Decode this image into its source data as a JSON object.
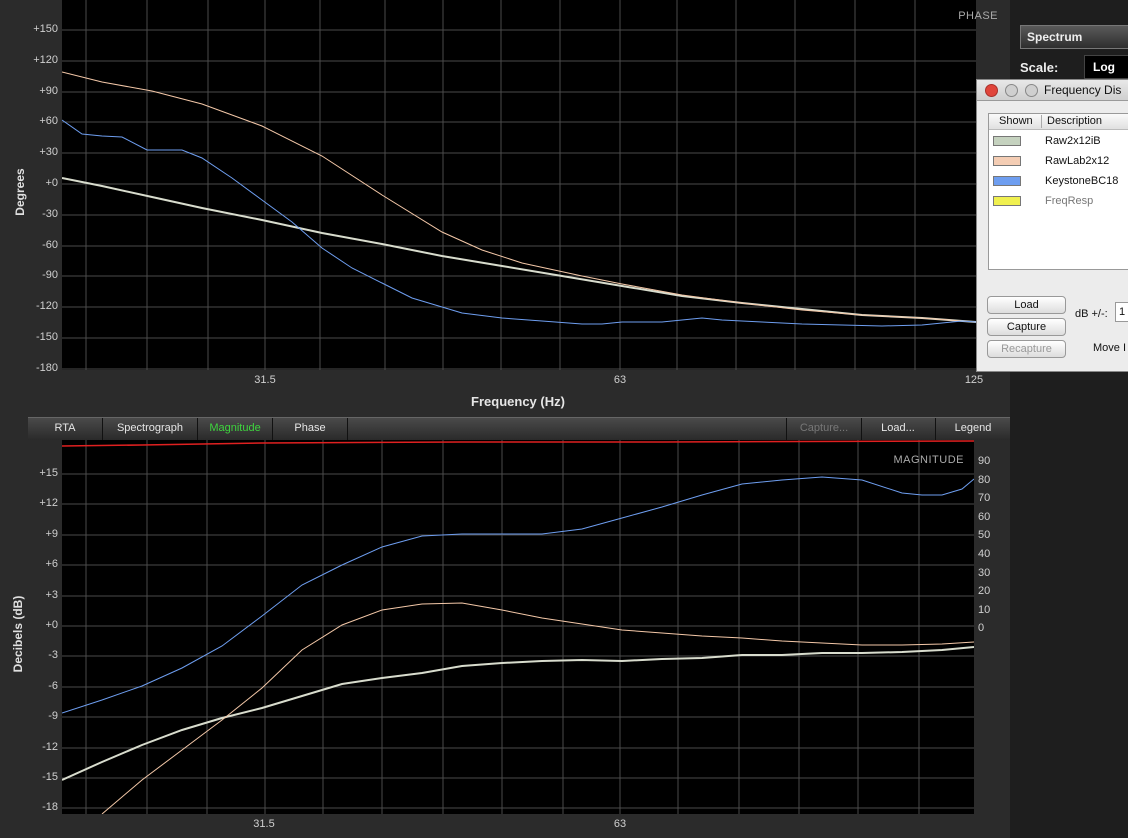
{
  "phase_plot": {
    "tag": "PHASE",
    "ylabel": "Degrees",
    "xlabel": "Frequency (Hz)",
    "yticks": [
      "+150",
      "+120",
      "+90",
      "+60",
      "+30",
      "+0",
      "-30",
      "-60",
      "-90",
      "-120",
      "-150",
      "-180"
    ],
    "xticks": [
      "31.5",
      "63",
      "125"
    ]
  },
  "tabs": {
    "rta": "RTA",
    "spectrograph": "Spectrograph",
    "magnitude": "Magnitude",
    "phase": "Phase",
    "capture": "Capture...",
    "load": "Load...",
    "legend": "Legend"
  },
  "magnitude_plot": {
    "tag": "MAGNITUDE",
    "ylabel": "Decibels (dB)",
    "yticks": [
      "+15",
      "+12",
      "+9",
      "+6",
      "+3",
      "+0",
      "-3",
      "-6",
      "-9",
      "-12",
      "-15",
      "-18"
    ],
    "yticks_right": [
      "90",
      "80",
      "70",
      "60",
      "50",
      "40",
      "30",
      "20",
      "10",
      "0"
    ],
    "xticks": [
      "31.5",
      "63"
    ]
  },
  "right_panel": {
    "spectrum_button": "Spectrum",
    "scale_label": "Scale:",
    "scale_value": "Log"
  },
  "dialog": {
    "title": "Frequency Dis",
    "col_shown": "Shown",
    "col_description": "Description",
    "items": [
      {
        "name": "Raw2x12iB",
        "color": "#c5d2bf"
      },
      {
        "name": "RawLab2x12",
        "color": "#f4cdb4"
      },
      {
        "name": "KeystoneBC18",
        "color": "#6e9ef0"
      },
      {
        "name": "FreqResp",
        "color": "#f0f050"
      }
    ],
    "load": "Load",
    "capture": "Capture",
    "recapture": "Recapture",
    "db_label": "dB +/-:",
    "db_value": "1",
    "move_label": "Move I"
  }
}
